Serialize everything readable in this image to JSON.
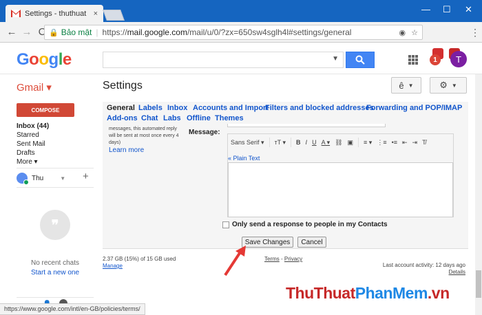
{
  "browser": {
    "tab_title": "Settings - thuthuat",
    "tab_close": "×",
    "win_minimize": "—",
    "win_maximize": "☐",
    "win_close": "✕",
    "back": "←",
    "forward": "→",
    "reload": "C",
    "secure_label": "Bảo mật",
    "url_scheme": "https://",
    "url_host": "mail.google.com",
    "url_rest": "/mail/u/0/?zx=650sw4sglh4l#settings/general",
    "menu": "⋮"
  },
  "header": {
    "logo": [
      "G",
      "o",
      "o",
      "g",
      "l",
      "e"
    ],
    "logo_colors": [
      "#4285f4",
      "#ea4335",
      "#fbbc05",
      "#4285f4",
      "#34a853",
      "#ea4335"
    ],
    "search_placeholder": "",
    "notif_count": "1",
    "avatar_letter": "T"
  },
  "subheader": {
    "gmail_label": "Gmail ▾",
    "title": "Settings",
    "lang_btn": "ê",
    "settings_btn": "⚙"
  },
  "sidebar": {
    "compose": "COMPOSE",
    "items": [
      {
        "label": "Inbox (44)",
        "bold": true
      },
      {
        "label": "Starred",
        "bold": false
      },
      {
        "label": "Sent Mail",
        "bold": false
      },
      {
        "label": "Drafts",
        "bold": false
      },
      {
        "label": "More ▾",
        "bold": false
      }
    ],
    "hangout_name": "Thu",
    "hangout_plus": "+",
    "chat_icon": "❞",
    "no_chats": "No recent chats",
    "start_new": "Start a new one"
  },
  "settings_tabs": [
    {
      "label": "General",
      "active": true
    },
    {
      "label": "Labels",
      "active": false
    },
    {
      "label": "Inbox",
      "active": false
    },
    {
      "label": "Accounts and Import",
      "active": false
    },
    {
      "label": "Filters and blocked addresses",
      "active": false
    },
    {
      "label": "Forwarding and POP/IMAP",
      "active": false
    },
    {
      "label": "Add-ons",
      "active": false
    },
    {
      "label": "Chat",
      "active": false
    },
    {
      "label": "Labs",
      "active": false
    },
    {
      "label": "Offline",
      "active": false
    },
    {
      "label": "Themes",
      "active": false
    }
  ],
  "vacation": {
    "note": "messages, this automated reply will be sent at most once every 4 days)",
    "learn_more": "Learn more",
    "message_label": "Message:",
    "font": "Sans Serif",
    "plain_text": "« Plain Text",
    "only_send": "Only send a response to people in my Contacts",
    "save": "Save Changes",
    "cancel": "Cancel"
  },
  "footer": {
    "storage": "2.37 GB (15%) of 15 GB used",
    "manage": "Manage",
    "terms": "Terms",
    "separator": "-",
    "privacy": "Privacy",
    "activity": "Last account activity: 12 days ago",
    "details": "Details"
  },
  "watermark": {
    "parts": [
      "Thu",
      "Thuat",
      "Phan",
      "Mem",
      ".vn"
    ],
    "colors": [
      "#c62828",
      "#c62828",
      "#1e88e5",
      "#1e88e5",
      "#c62828"
    ]
  },
  "statusbar": "https://www.google.com/intl/en-GB/policies/terms/",
  "colors": {
    "accent": "#4285f4",
    "compose": "#d14836",
    "link": "#1155cc",
    "arrow": "#e53935"
  }
}
